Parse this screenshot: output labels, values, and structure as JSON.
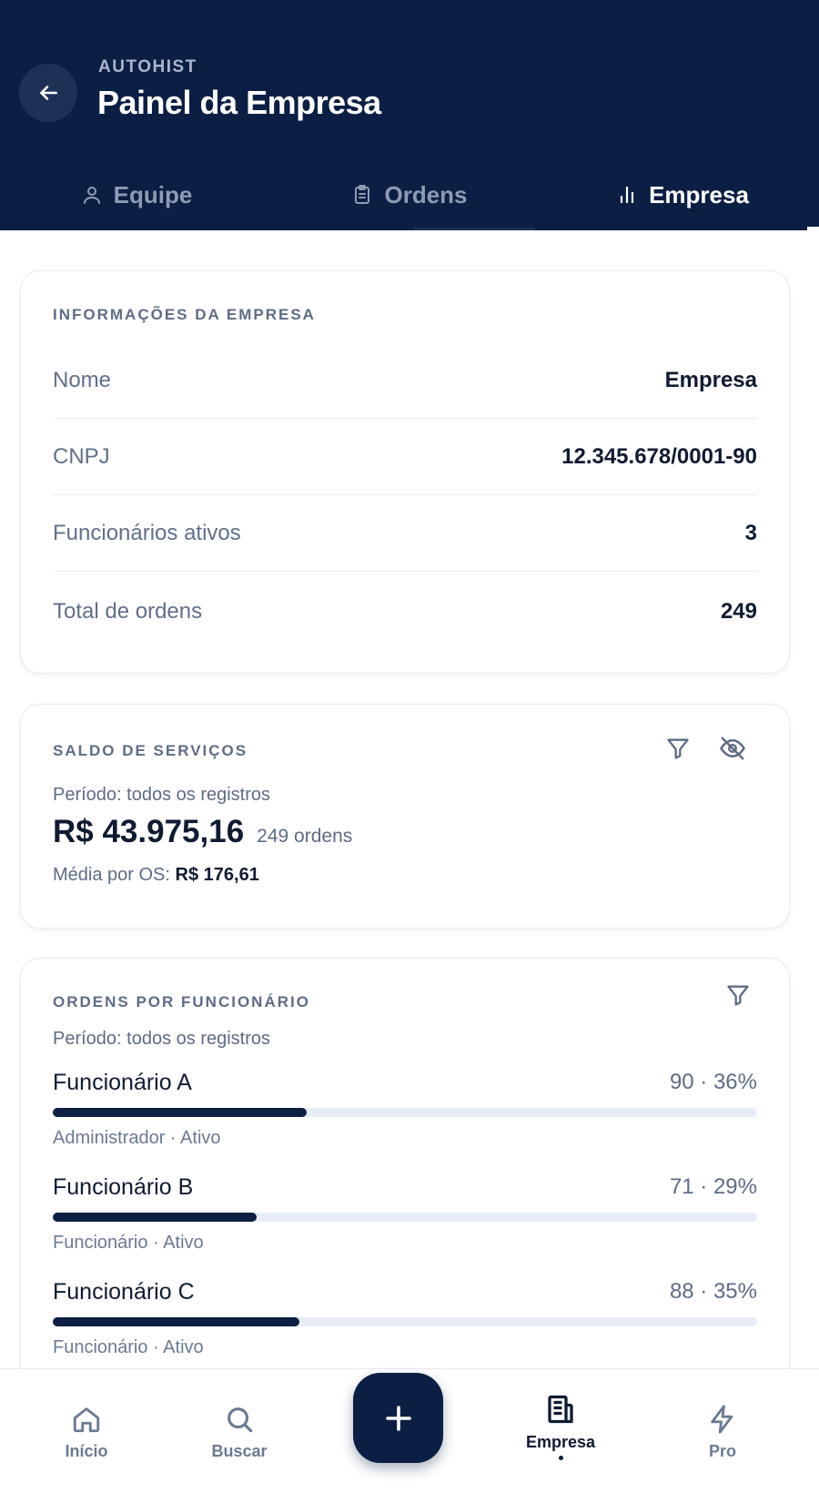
{
  "header": {
    "app_name": "AUTOHIST",
    "title": "Painel da Empresa",
    "tabs": [
      {
        "label": "Equipe",
        "icon": "user-icon"
      },
      {
        "label": "Ordens",
        "icon": "clipboard-icon"
      },
      {
        "label": "Empresa",
        "icon": "bar-chart-icon",
        "active": true
      }
    ]
  },
  "company_info": {
    "title": "INFORMAÇÕES DA EMPRESA",
    "rows": [
      {
        "label": "Nome",
        "value": "Empresa"
      },
      {
        "label": "CNPJ",
        "value": "12.345.678/0001-90"
      },
      {
        "label": "Funcionários ativos",
        "value": "3"
      },
      {
        "label": "Total de ordens",
        "value": "249"
      }
    ]
  },
  "balance": {
    "title": "SALDO DE SERVIÇOS",
    "period": "Período: todos os registros",
    "amount": "R$ 43.975,16",
    "orders": "249 ordens",
    "avg_label": "Média por OS: ",
    "avg_value": "R$ 176,61",
    "icons": [
      "filter-icon",
      "eye-off-icon"
    ]
  },
  "orders_by_employee": {
    "title": "ORDENS POR FUNCIONÁRIO",
    "period": "Período: todos os registros",
    "employees": [
      {
        "name": "Funcionário A",
        "stat": "90 · 36%",
        "fraction": 0.36,
        "role": "Administrador · Ativo"
      },
      {
        "name": "Funcionário B",
        "stat": "71 · 29%",
        "fraction": 0.29,
        "role": "Funcionário · Ativo"
      },
      {
        "name": "Funcionário C",
        "stat": "88 · 35%",
        "fraction": 0.35,
        "role": "Funcionário · Ativo"
      }
    ]
  },
  "bottom_nav": {
    "items": [
      {
        "label": "Início",
        "icon": "home-icon"
      },
      {
        "label": "Buscar",
        "icon": "search-icon"
      },
      {
        "label": "Empresa",
        "icon": "building-icon",
        "active": true
      },
      {
        "label": "Pro",
        "icon": "lightning-icon"
      }
    ],
    "fab_icon": "plus-icon"
  },
  "colors": {
    "header_bg": "#0b1f44",
    "accent": "#0d1f42",
    "muted_text": "#5d6c86"
  }
}
